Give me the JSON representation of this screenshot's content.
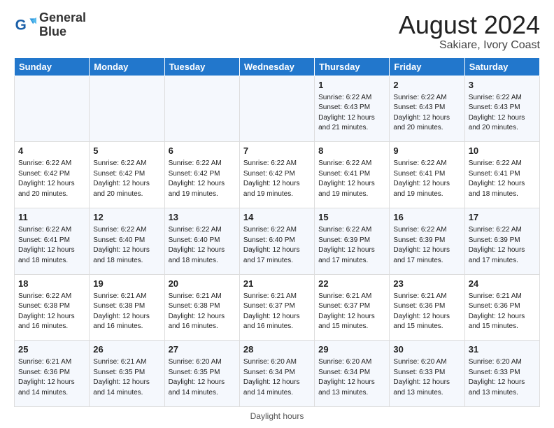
{
  "logo": {
    "line1": "General",
    "line2": "Blue"
  },
  "title": {
    "main": "August 2024",
    "sub": "Sakiare, Ivory Coast"
  },
  "days_of_week": [
    "Sunday",
    "Monday",
    "Tuesday",
    "Wednesday",
    "Thursday",
    "Friday",
    "Saturday"
  ],
  "weeks": [
    [
      {
        "day": "",
        "info": ""
      },
      {
        "day": "",
        "info": ""
      },
      {
        "day": "",
        "info": ""
      },
      {
        "day": "",
        "info": ""
      },
      {
        "day": "1",
        "info": "Sunrise: 6:22 AM\nSunset: 6:43 PM\nDaylight: 12 hours and 21 minutes."
      },
      {
        "day": "2",
        "info": "Sunrise: 6:22 AM\nSunset: 6:43 PM\nDaylight: 12 hours and 20 minutes."
      },
      {
        "day": "3",
        "info": "Sunrise: 6:22 AM\nSunset: 6:43 PM\nDaylight: 12 hours and 20 minutes."
      }
    ],
    [
      {
        "day": "4",
        "info": "Sunrise: 6:22 AM\nSunset: 6:42 PM\nDaylight: 12 hours and 20 minutes."
      },
      {
        "day": "5",
        "info": "Sunrise: 6:22 AM\nSunset: 6:42 PM\nDaylight: 12 hours and 20 minutes."
      },
      {
        "day": "6",
        "info": "Sunrise: 6:22 AM\nSunset: 6:42 PM\nDaylight: 12 hours and 19 minutes."
      },
      {
        "day": "7",
        "info": "Sunrise: 6:22 AM\nSunset: 6:42 PM\nDaylight: 12 hours and 19 minutes."
      },
      {
        "day": "8",
        "info": "Sunrise: 6:22 AM\nSunset: 6:41 PM\nDaylight: 12 hours and 19 minutes."
      },
      {
        "day": "9",
        "info": "Sunrise: 6:22 AM\nSunset: 6:41 PM\nDaylight: 12 hours and 19 minutes."
      },
      {
        "day": "10",
        "info": "Sunrise: 6:22 AM\nSunset: 6:41 PM\nDaylight: 12 hours and 18 minutes."
      }
    ],
    [
      {
        "day": "11",
        "info": "Sunrise: 6:22 AM\nSunset: 6:41 PM\nDaylight: 12 hours and 18 minutes."
      },
      {
        "day": "12",
        "info": "Sunrise: 6:22 AM\nSunset: 6:40 PM\nDaylight: 12 hours and 18 minutes."
      },
      {
        "day": "13",
        "info": "Sunrise: 6:22 AM\nSunset: 6:40 PM\nDaylight: 12 hours and 18 minutes."
      },
      {
        "day": "14",
        "info": "Sunrise: 6:22 AM\nSunset: 6:40 PM\nDaylight: 12 hours and 17 minutes."
      },
      {
        "day": "15",
        "info": "Sunrise: 6:22 AM\nSunset: 6:39 PM\nDaylight: 12 hours and 17 minutes."
      },
      {
        "day": "16",
        "info": "Sunrise: 6:22 AM\nSunset: 6:39 PM\nDaylight: 12 hours and 17 minutes."
      },
      {
        "day": "17",
        "info": "Sunrise: 6:22 AM\nSunset: 6:39 PM\nDaylight: 12 hours and 17 minutes."
      }
    ],
    [
      {
        "day": "18",
        "info": "Sunrise: 6:22 AM\nSunset: 6:38 PM\nDaylight: 12 hours and 16 minutes."
      },
      {
        "day": "19",
        "info": "Sunrise: 6:21 AM\nSunset: 6:38 PM\nDaylight: 12 hours and 16 minutes."
      },
      {
        "day": "20",
        "info": "Sunrise: 6:21 AM\nSunset: 6:38 PM\nDaylight: 12 hours and 16 minutes."
      },
      {
        "day": "21",
        "info": "Sunrise: 6:21 AM\nSunset: 6:37 PM\nDaylight: 12 hours and 16 minutes."
      },
      {
        "day": "22",
        "info": "Sunrise: 6:21 AM\nSunset: 6:37 PM\nDaylight: 12 hours and 15 minutes."
      },
      {
        "day": "23",
        "info": "Sunrise: 6:21 AM\nSunset: 6:36 PM\nDaylight: 12 hours and 15 minutes."
      },
      {
        "day": "24",
        "info": "Sunrise: 6:21 AM\nSunset: 6:36 PM\nDaylight: 12 hours and 15 minutes."
      }
    ],
    [
      {
        "day": "25",
        "info": "Sunrise: 6:21 AM\nSunset: 6:36 PM\nDaylight: 12 hours and 14 minutes."
      },
      {
        "day": "26",
        "info": "Sunrise: 6:21 AM\nSunset: 6:35 PM\nDaylight: 12 hours and 14 minutes."
      },
      {
        "day": "27",
        "info": "Sunrise: 6:20 AM\nSunset: 6:35 PM\nDaylight: 12 hours and 14 minutes."
      },
      {
        "day": "28",
        "info": "Sunrise: 6:20 AM\nSunset: 6:34 PM\nDaylight: 12 hours and 14 minutes."
      },
      {
        "day": "29",
        "info": "Sunrise: 6:20 AM\nSunset: 6:34 PM\nDaylight: 12 hours and 13 minutes."
      },
      {
        "day": "30",
        "info": "Sunrise: 6:20 AM\nSunset: 6:33 PM\nDaylight: 12 hours and 13 minutes."
      },
      {
        "day": "31",
        "info": "Sunrise: 6:20 AM\nSunset: 6:33 PM\nDaylight: 12 hours and 13 minutes."
      }
    ]
  ],
  "footer": {
    "text": "Daylight hours"
  }
}
